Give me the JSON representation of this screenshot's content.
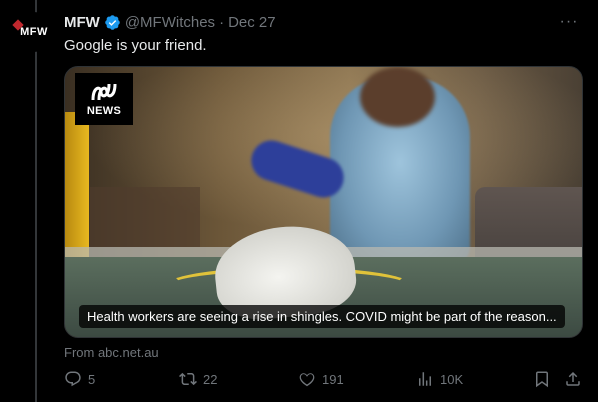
{
  "author": {
    "avatar_text": "MFW",
    "name": "MFW",
    "handle": "@MFWitches",
    "separator": "·",
    "date": "Dec 27"
  },
  "more_label": "···",
  "tweet_text": "Google is your friend.",
  "card": {
    "badge_text": "NEWS",
    "caption": "Health workers are seeing a rise in shingles. COVID might be part of the reason...",
    "source": "From abc.net.au"
  },
  "actions": {
    "replies": "5",
    "retweets": "22",
    "likes": "191",
    "views": "10K"
  },
  "colors": {
    "background": "#000000",
    "muted": "#71767b",
    "verified": "#1d9bf0",
    "text": "#e7e9ea"
  }
}
